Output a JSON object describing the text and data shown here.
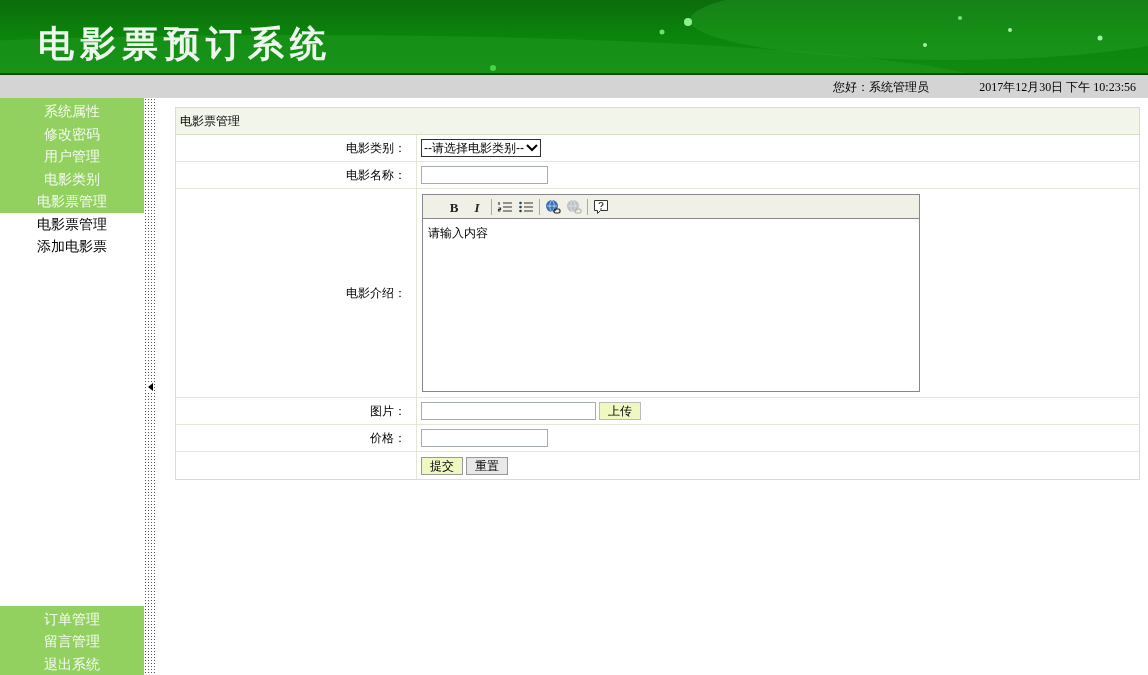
{
  "header": {
    "title": "电影票预订系统"
  },
  "status_bar": {
    "greeting": "您好：系统管理员",
    "datetime": "2017年12月30日 下午 10:23:56"
  },
  "sidebar": {
    "top_items": [
      {
        "label": "系统属性"
      },
      {
        "label": "修改密码"
      },
      {
        "label": "用户管理"
      },
      {
        "label": "电影类别"
      },
      {
        "label": "电影票管理",
        "children": [
          {
            "label": "电影票管理"
          },
          {
            "label": "添加电影票"
          }
        ]
      }
    ],
    "bottom_items": [
      {
        "label": "订单管理"
      },
      {
        "label": "留言管理"
      },
      {
        "label": "退出系统"
      }
    ]
  },
  "form": {
    "title": "电影票管理",
    "rows": [
      {
        "kind": "select",
        "label": "电影类别：",
        "value": "--请选择电影类别--"
      },
      {
        "kind": "text",
        "label": "电影名称："
      },
      {
        "kind": "editor",
        "label": "电影介绍：",
        "value": "请输入内容",
        "toolbar": [
          {
            "kind": "bold",
            "label": "B",
            "disabled": false
          },
          {
            "kind": "italic",
            "label": "I",
            "disabled": false
          },
          {
            "kind": "separator"
          },
          {
            "kind": "ordered-list",
            "disabled": false
          },
          {
            "kind": "bullet-list",
            "disabled": false
          },
          {
            "kind": "separator"
          },
          {
            "kind": "link",
            "disabled": false
          },
          {
            "kind": "unlink",
            "disabled": true
          },
          {
            "kind": "separator"
          },
          {
            "kind": "help",
            "disabled": false
          }
        ]
      },
      {
        "kind": "upload",
        "label": "图片：",
        "button": "上传"
      },
      {
        "kind": "text",
        "label": "价格："
      },
      {
        "kind": "buttons",
        "buttons": [
          {
            "label": "提交",
            "primary": true
          },
          {
            "label": "重置",
            "primary": false
          }
        ]
      }
    ]
  }
}
